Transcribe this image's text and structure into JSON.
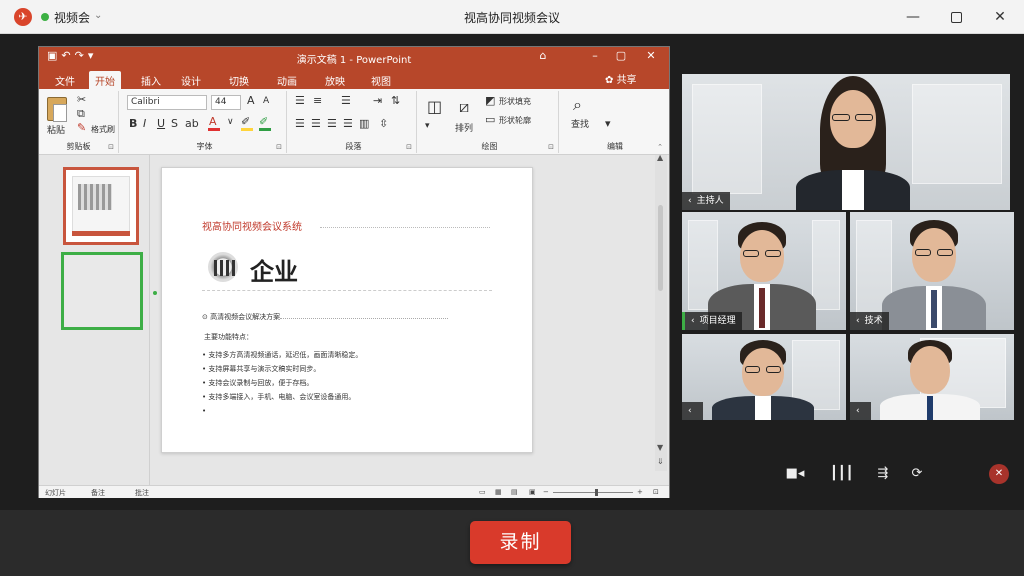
{
  "app": {
    "name": "视频会",
    "window_title": "视高协同视频会议",
    "logo_icon": "plane-icon",
    "status_color": "#3cb043"
  },
  "ppt": {
    "doc_title": "演示文稿 1 - PowerPoint",
    "qat_icons": [
      "save-icon",
      "undo-icon",
      "redo-icon",
      "customize-icon"
    ],
    "tabs": [
      "文件",
      "开始",
      "插入",
      "设计",
      "切换",
      "动画",
      "放映",
      "视图"
    ],
    "active_tab": "开始",
    "share_label": "共享",
    "ribbon": {
      "clipboard": {
        "label": "剪贴板",
        "paste": "粘贴",
        "format_painter": "格式刷"
      },
      "font": {
        "label": "字体",
        "font_name": "Calibri",
        "font_size": "44"
      },
      "paragraph": {
        "label": "段落"
      },
      "drawing": {
        "label": "绘图",
        "shape_fill": "形状填充",
        "shape_outline": "形状轮廓",
        "arrange": "排列"
      },
      "editing": {
        "label": "编辑",
        "find": "查找"
      }
    },
    "slide": {
      "title": "视高协同视频会议系统",
      "heading": "企业",
      "bullet1": "高清视频会议解决方案",
      "subheading": "主要功能特点：",
      "items": [
        "支持多方高清视频通话，延迟低，画面清晰稳定。",
        "支持屏幕共享与演示文稿实时同步。",
        "支持会议录制与回放，便于存档。",
        "支持多端接入，手机、电脑、会议室设备通用。",
        ""
      ]
    },
    "status": {
      "slide": "幻灯片",
      "notes": "备注",
      "comments": "批注"
    },
    "accent_color": "#b7472a"
  },
  "participants": [
    {
      "name": "主持人",
      "active": false
    },
    {
      "name": "项目经理",
      "active": true
    },
    {
      "name": "技术",
      "active": false
    },
    {
      "name": "",
      "active": false
    },
    {
      "name": "",
      "active": false
    }
  ],
  "meeting_controls": [
    "camera-icon",
    "audio-level-icon",
    "share-screen-icon",
    "switch-icon",
    "leave-icon"
  ],
  "record_label": "录制",
  "record_color": "#d93a2b"
}
